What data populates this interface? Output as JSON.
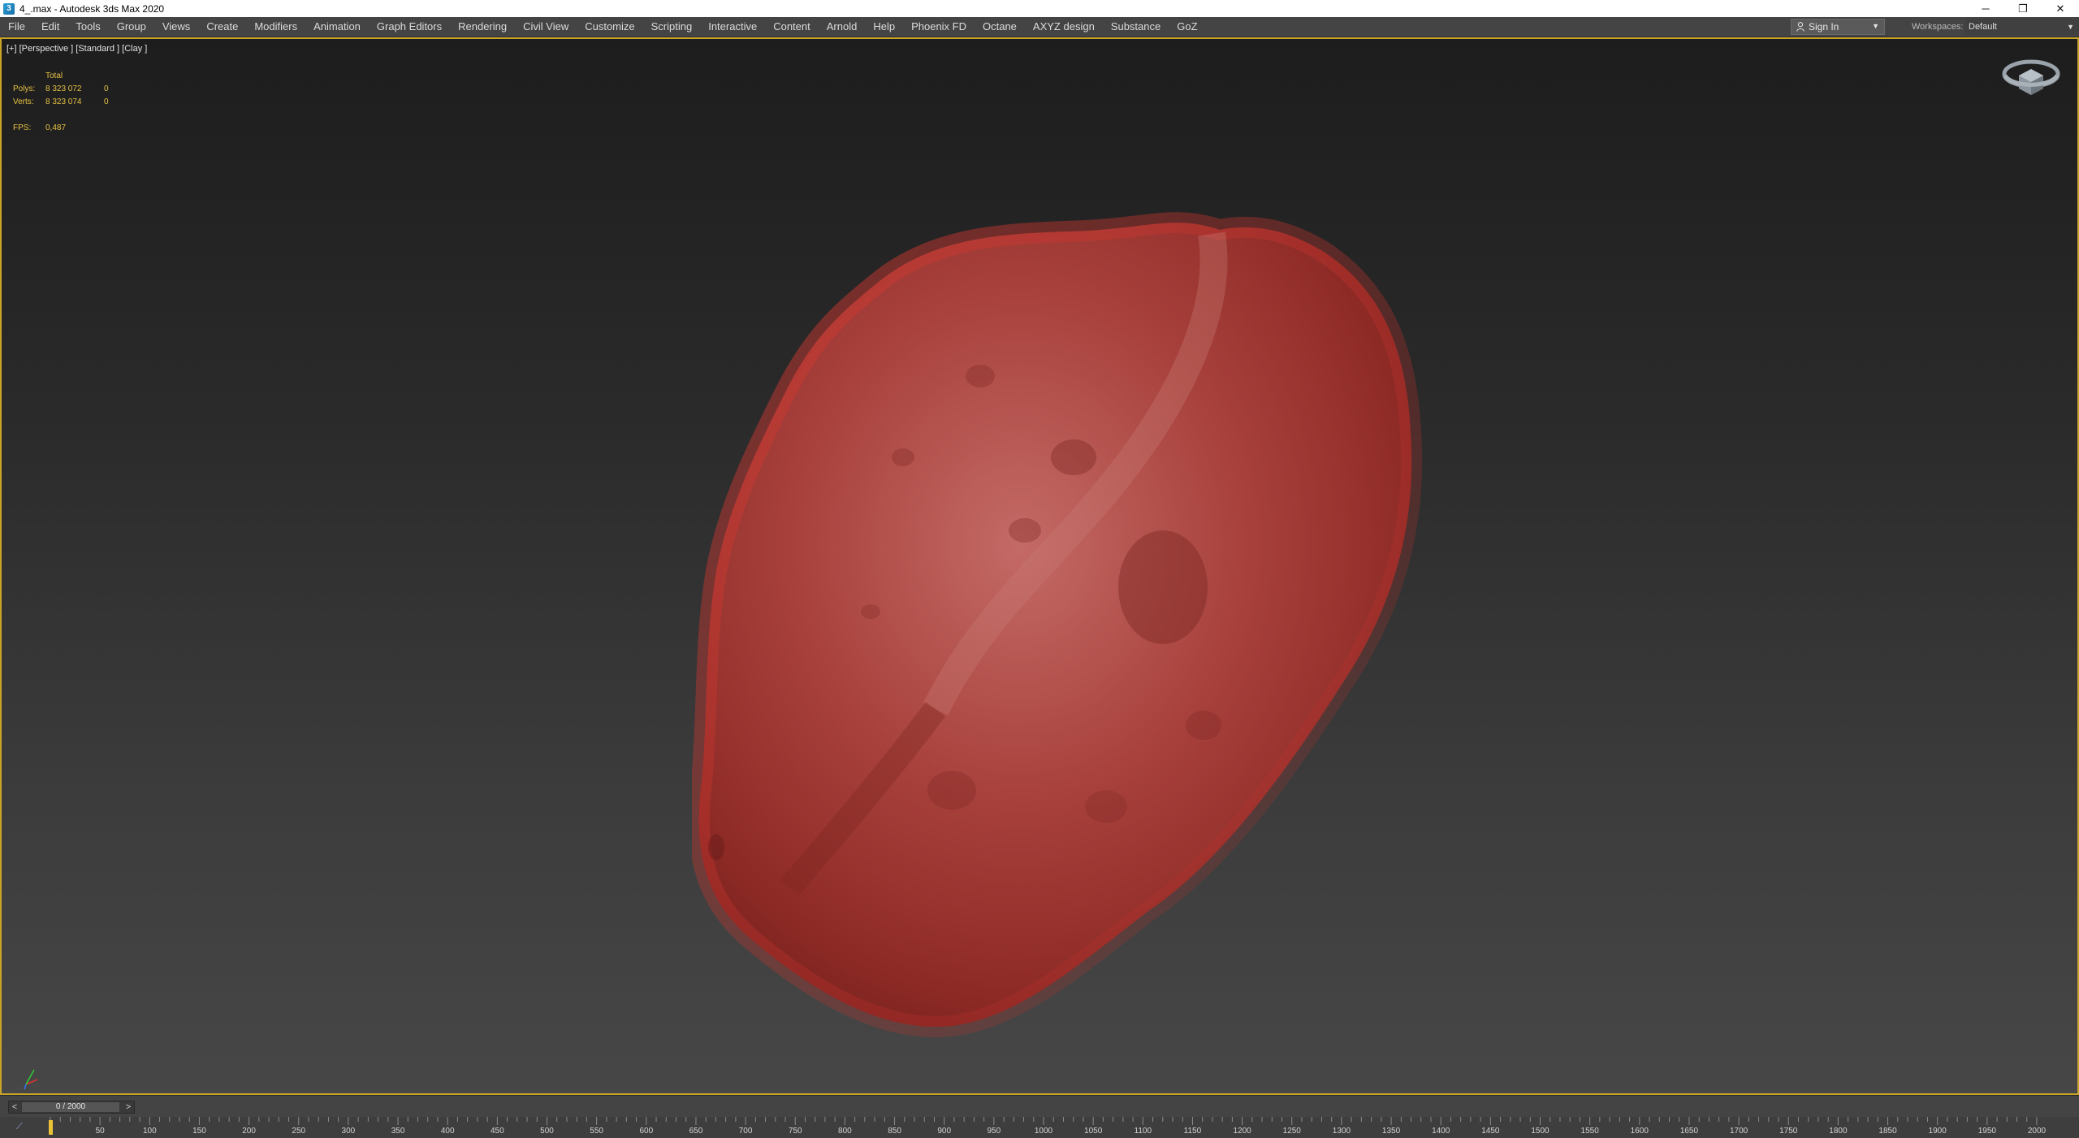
{
  "window": {
    "title": "4_.max - Autodesk 3ds Max 2020",
    "minimize": "─",
    "restore": "❐",
    "close": "✕"
  },
  "menu": [
    "File",
    "Edit",
    "Tools",
    "Group",
    "Views",
    "Create",
    "Modifiers",
    "Animation",
    "Graph Editors",
    "Rendering",
    "Civil View",
    "Customize",
    "Scripting",
    "Interactive",
    "Content",
    "Arnold",
    "Help",
    "Phoenix FD",
    "Octane",
    "AXYZ design",
    "Substance",
    "GoZ"
  ],
  "signin": {
    "label": "Sign In"
  },
  "workspaces": {
    "label": "Workspaces:",
    "value": "Default"
  },
  "viewport": {
    "label": "[+] [Perspective ] [Standard ] [Clay ]",
    "stats": {
      "header": "Total",
      "polys_label": "Polys:",
      "polys_value": "8 323 072",
      "polys_sel": "0",
      "verts_label": "Verts:",
      "verts_value": "8 323 074",
      "verts_sel": "0",
      "fps_label": "FPS:",
      "fps_value": "0,487"
    }
  },
  "timeline": {
    "slider_value": "0 / 2000",
    "prev": "<",
    "next": ">",
    "ticks": [
      "50",
      "100",
      "150",
      "200",
      "250",
      "300",
      "350",
      "400",
      "450",
      "500",
      "550",
      "600",
      "650",
      "700",
      "750",
      "800",
      "850",
      "900",
      "950",
      "1000",
      "1050",
      "1100",
      "1150",
      "1200",
      "1250",
      "1300",
      "1350",
      "1400",
      "1450",
      "1500",
      "1550",
      "1600",
      "1650",
      "1700",
      "1750",
      "1800",
      "1850",
      "1900",
      "1950",
      "2000"
    ]
  },
  "colors": {
    "accent": "#c8a427",
    "stats_text": "#e7c243",
    "rock": "#b8342e"
  }
}
